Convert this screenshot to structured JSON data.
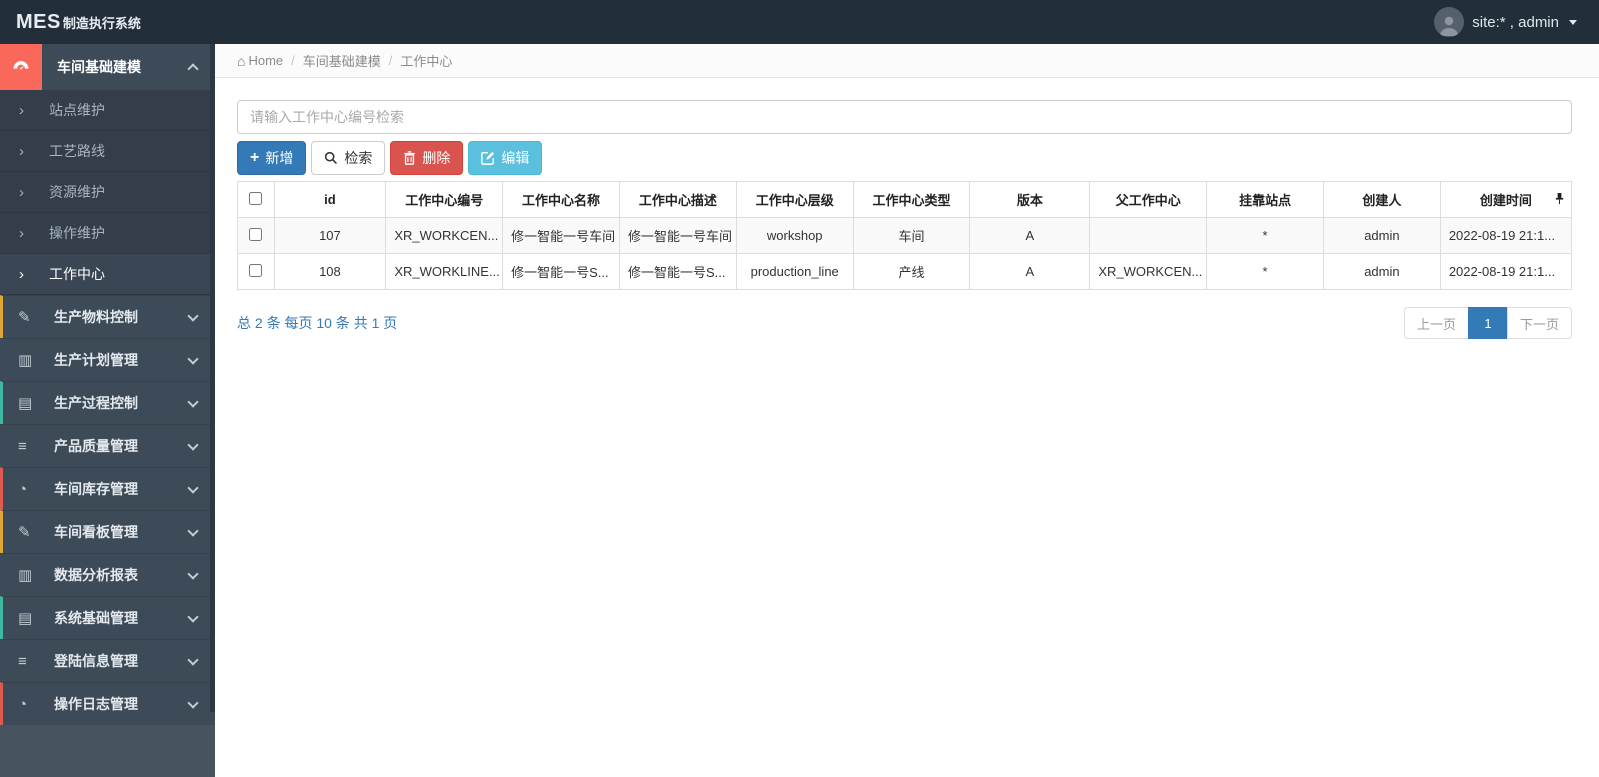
{
  "navbar": {
    "logo_bold": "MES",
    "logo_rest": "制造执行系统",
    "user_name": "site:* , admin"
  },
  "breadcrumb": {
    "home": "Home",
    "home_icon": "⌂",
    "separator": "/",
    "section": "车间基础建模",
    "current": "工作中心"
  },
  "sidebar": {
    "group": {
      "label": "车间基础建模",
      "icon": "gauge-icon",
      "accent": "#f9685a"
    },
    "subitems": [
      {
        "label": "站点维护",
        "arrow": "›",
        "active": false
      },
      {
        "label": "工艺路线",
        "arrow": "›",
        "active": false
      },
      {
        "label": "资源维护",
        "arrow": "›",
        "active": false
      },
      {
        "label": "操作维护",
        "arrow": "›",
        "active": false
      },
      {
        "label": "工作中心",
        "arrow": "›",
        "active": true
      }
    ],
    "items": [
      {
        "label": "生产物料控制",
        "icon": "pencil-icon",
        "glyph": "✎",
        "accent": "#e0a832"
      },
      {
        "label": "生产计划管理",
        "icon": "columns-icon",
        "glyph": "▥",
        "accent": "transparent"
      },
      {
        "label": "生产过程控制",
        "icon": "book-icon",
        "glyph": "▤",
        "accent": "#3eb8a0"
      },
      {
        "label": "产品质量管理",
        "icon": "list-icon",
        "glyph": "≡",
        "accent": "transparent"
      },
      {
        "label": "车间库存管理",
        "icon": "gauge-icon",
        "glyph": "◔",
        "accent": "#df5a4e"
      },
      {
        "label": "车间看板管理",
        "icon": "pencil-icon",
        "glyph": "✎",
        "accent": "#e0a832"
      },
      {
        "label": "数据分析报表",
        "icon": "columns-icon",
        "glyph": "▥",
        "accent": "transparent"
      },
      {
        "label": "系统基础管理",
        "icon": "book-icon",
        "glyph": "▤",
        "accent": "#3eb8a0"
      },
      {
        "label": "登陆信息管理",
        "icon": "list-icon",
        "glyph": "≡",
        "accent": "transparent"
      },
      {
        "label": "操作日志管理",
        "icon": "gauge-icon",
        "glyph": "◔",
        "accent": "#df5a4e"
      }
    ]
  },
  "toolbar": {
    "search_placeholder": "请输入工作中心编号检索",
    "add_label": "新增",
    "search_label": "检索",
    "delete_label": "删除",
    "edit_label": "编辑"
  },
  "table": {
    "columns": [
      "id",
      "工作中心编号",
      "工作中心名称",
      "工作中心描述",
      "工作中心层级",
      "工作中心类型",
      "版本",
      "父工作中心",
      "挂靠站点",
      "创建人",
      "创建时间"
    ],
    "rows": [
      {
        "cells": [
          "107",
          "XR_WORKCEN...",
          "修一智能一号车间",
          "修一智能一号车间",
          "workshop",
          "车间",
          "A",
          "",
          "*",
          "admin",
          "2022-08-19 21:1..."
        ]
      },
      {
        "cells": [
          "108",
          "XR_WORKLINE...",
          "修一智能一号S...",
          "修一智能一号S...",
          "production_line",
          "产线",
          "A",
          "XR_WORKCEN...",
          "*",
          "admin",
          "2022-08-19 21:1..."
        ]
      }
    ]
  },
  "pagination": {
    "summary": "总 2 条 每页 10 条 共 1 页",
    "prev_label": "上一页",
    "page_label": "1",
    "next_label": "下一页"
  },
  "colors": {
    "navbar_bg": "#232e3b",
    "sidebar_bg": "#47545f",
    "group_accent": "#f9685a",
    "primary": "#337ab7",
    "danger": "#d9534f",
    "info": "#5bc0de",
    "active_page_bg": "#337ab7"
  }
}
